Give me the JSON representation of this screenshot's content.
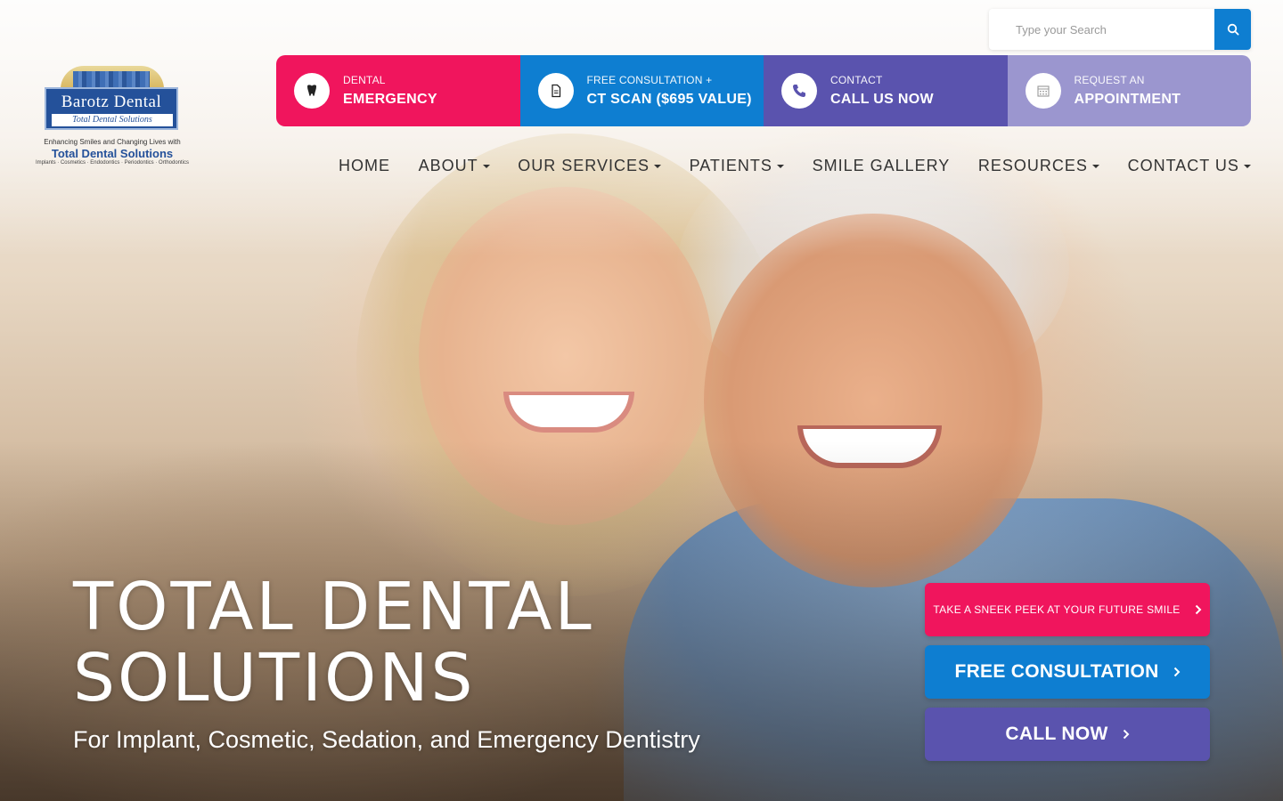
{
  "logo": {
    "name": "Barotz Dental",
    "tagline": "Total Dental Solutions",
    "line1": "Enhancing Smiles and Changing Lives with",
    "line2": "Total Dental Solutions",
    "line3": "Implants · Cosmetics · Endodontics · Periodontics · Orthodontics"
  },
  "search": {
    "placeholder": "Type your Search",
    "icon": "search-icon"
  },
  "quick_actions": [
    {
      "small": "DENTAL",
      "big": "EMERGENCY",
      "icon": "tooth-icon",
      "color": "#f0155d"
    },
    {
      "small": "FREE CONSULTATION +",
      "big": "CT SCAN ($695 VALUE)",
      "icon": "document-icon",
      "color": "#0e7ed1"
    },
    {
      "small": "CONTACT",
      "big": "CALL US NOW",
      "icon": "phone-icon",
      "color": "#5a53ae"
    },
    {
      "small": "REQUEST AN",
      "big": "APPOINTMENT",
      "icon": "calendar-icon",
      "color": "#9b96cf"
    }
  ],
  "nav": [
    {
      "label": "HOME",
      "dropdown": false
    },
    {
      "label": "ABOUT",
      "dropdown": true
    },
    {
      "label": "OUR SERVICES",
      "dropdown": true
    },
    {
      "label": "PATIENTS",
      "dropdown": true
    },
    {
      "label": "SMILE GALLERY",
      "dropdown": false
    },
    {
      "label": "RESOURCES",
      "dropdown": true
    },
    {
      "label": "CONTACT US",
      "dropdown": true
    }
  ],
  "hero": {
    "title_line1": "TOTAL DENTAL",
    "title_line2": "SOLUTIONS",
    "subtitle": "For Implant, Cosmetic, Sedation, and Emergency Dentistry"
  },
  "cta": [
    {
      "label": "TAKE A SNEEK PEEK AT YOUR FUTURE SMILE",
      "color": "#f0155d"
    },
    {
      "label": "FREE CONSULTATION",
      "color": "#0e7ed1"
    },
    {
      "label": "CALL NOW",
      "color": "#5a53ae"
    }
  ]
}
